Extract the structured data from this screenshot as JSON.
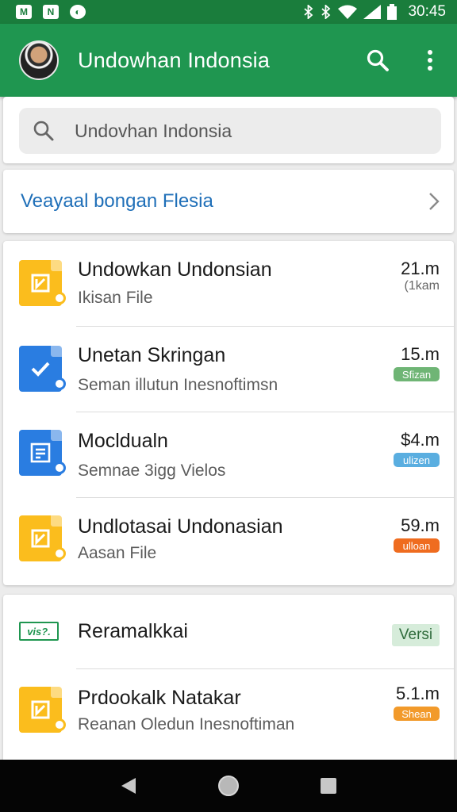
{
  "status_bar": {
    "left_icons": [
      "M",
      "N",
      "◐"
    ],
    "time": "30:45",
    "icons": [
      "bluetooth-icon",
      "bluetooth-icon",
      "wifi-icon",
      "signal-icon",
      "battery-icon"
    ]
  },
  "app_bar": {
    "title": "Undowhan Indonsia",
    "icons": [
      "search-icon",
      "more-vert-icon"
    ]
  },
  "search": {
    "value": "Undovhan Indonsia",
    "icon": "search-icon"
  },
  "link_row": {
    "label": "Veayaal bongan Flesia",
    "icon": "chevron-right-icon"
  },
  "list_card_1": [
    {
      "title": "Undowkan Undonsian",
      "subtitle": "Ikisan File",
      "size": "21.m",
      "meta": "(1kam",
      "icon": "yellow-doc-icon"
    },
    {
      "title": "Unetan Skringan",
      "subtitle": "Seman illutun Inesnoftimsn",
      "size": "15.m",
      "badge": "Sfizan",
      "badge_color": "#6fb575",
      "icon": "blue-check-doc-icon"
    },
    {
      "title": "Mocldualn",
      "subtitle": "Semnae 3igg Vielos",
      "size": "$4.m",
      "badge": "ulizen",
      "badge_color": "#5aaee0",
      "icon": "blue-form-doc-icon"
    },
    {
      "title": "Undlotasai Undonasian",
      "subtitle": "Aasan File",
      "size": "59.m",
      "badge": "ulloan",
      "badge_color": "#ef6c1f",
      "icon": "yellow-doc-icon"
    }
  ],
  "list_card_2": [
    {
      "logo_text": "vis?.",
      "title": "Reramalkkai",
      "version_label": "Versi"
    },
    {
      "title": "Prdookalk Natakar",
      "subtitle": "Reanan Oledun Inesnoftiman",
      "size": "5.1.m",
      "badge": "Shean",
      "badge_color": "#f29a2a",
      "icon": "yellow-doc-icon"
    }
  ],
  "nav_bar": {
    "icons": [
      "back-icon",
      "home-icon",
      "recents-icon"
    ]
  },
  "colors": {
    "status_bar": "#1a7d3c",
    "app_bar": "#1f9650",
    "link": "#1f6fb8",
    "yellow_icon": "#fbbd1d",
    "blue_icon": "#2a7de1"
  }
}
